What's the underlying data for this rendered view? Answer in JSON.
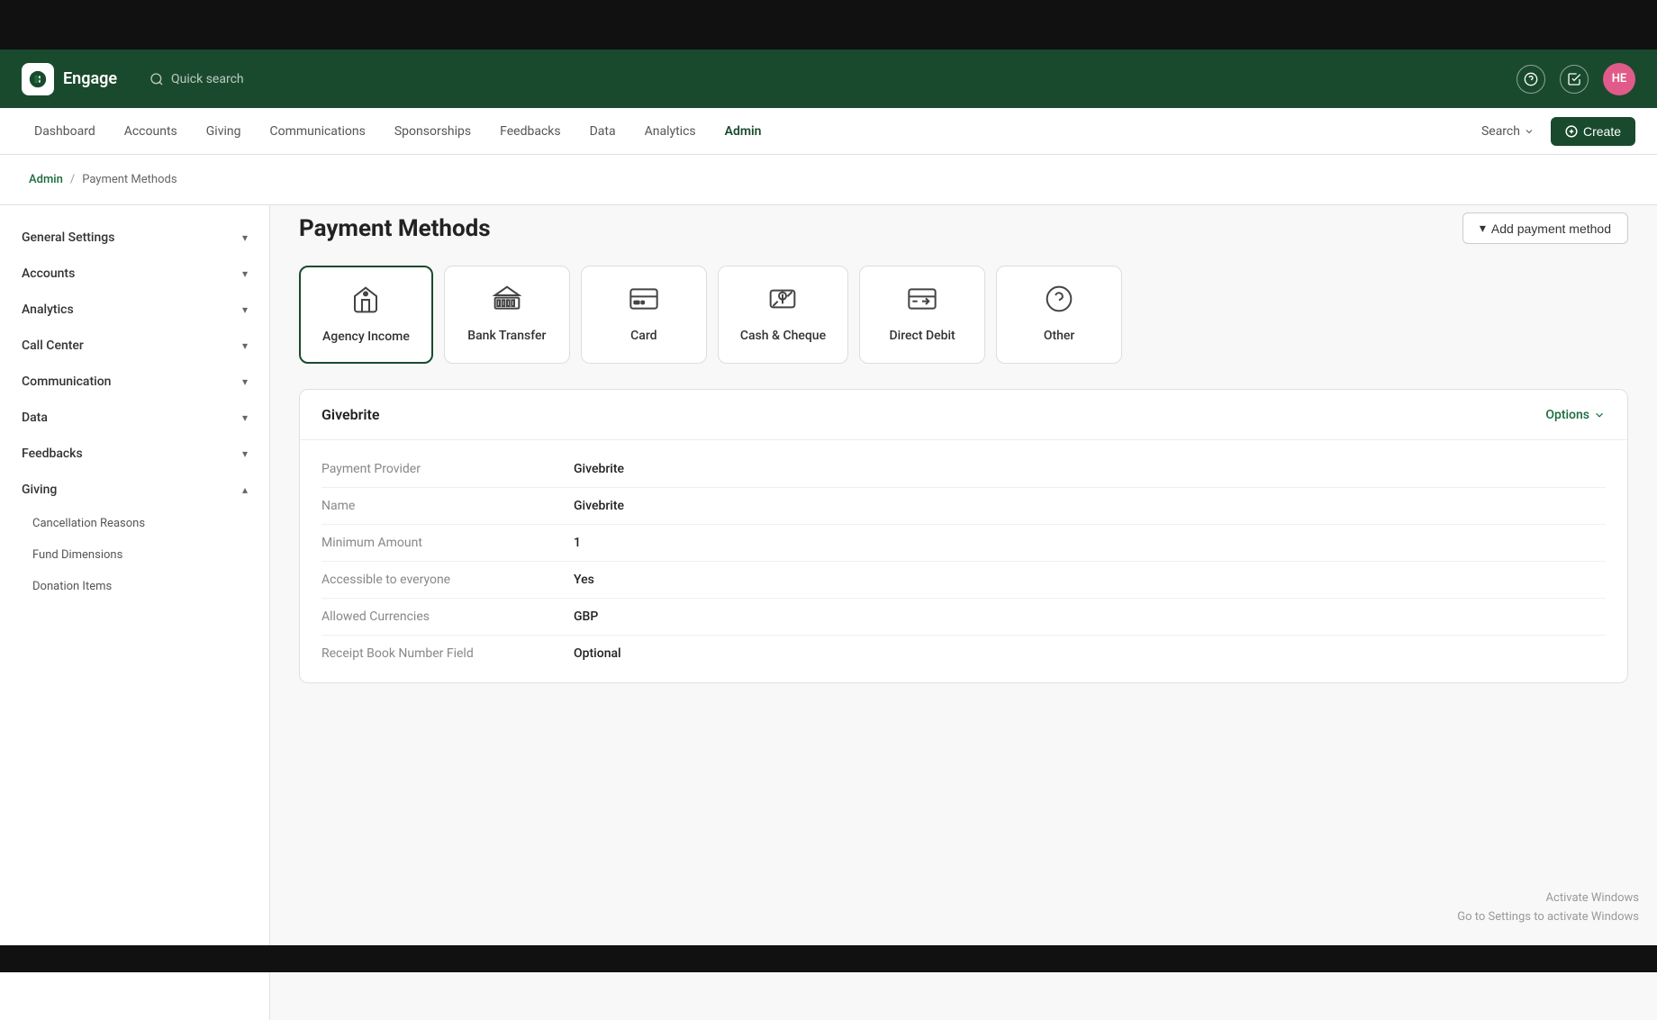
{
  "app": {
    "name": "Engage",
    "logo_alt": "engage-logo"
  },
  "header": {
    "search_placeholder": "Quick search",
    "avatar_initials": "HE"
  },
  "navbar": {
    "items": [
      {
        "label": "Dashboard",
        "active": false
      },
      {
        "label": "Accounts",
        "active": false
      },
      {
        "label": "Giving",
        "active": false
      },
      {
        "label": "Communications",
        "active": false
      },
      {
        "label": "Sponsorships",
        "active": false
      },
      {
        "label": "Feedbacks",
        "active": false
      },
      {
        "label": "Data",
        "active": false
      },
      {
        "label": "Analytics",
        "active": false
      },
      {
        "label": "Admin",
        "active": true
      }
    ],
    "search_label": "Search",
    "create_label": "Create"
  },
  "breadcrumb": {
    "parent": "Admin",
    "current": "Payment Methods"
  },
  "sidebar": {
    "items": [
      {
        "label": "General Settings",
        "expanded": false
      },
      {
        "label": "Accounts",
        "expanded": false
      },
      {
        "label": "Analytics",
        "expanded": false
      },
      {
        "label": "Call Center",
        "expanded": false
      },
      {
        "label": "Communication",
        "expanded": false
      },
      {
        "label": "Data",
        "expanded": false
      },
      {
        "label": "Feedbacks",
        "expanded": false
      },
      {
        "label": "Giving",
        "expanded": true
      }
    ],
    "giving_sub_items": [
      {
        "label": "Cancellation Reasons"
      },
      {
        "label": "Fund Dimensions"
      },
      {
        "label": "Donation Items"
      }
    ]
  },
  "page": {
    "title": "Payment Methods",
    "add_button": "Add payment method"
  },
  "payment_methods": [
    {
      "id": "agency-income",
      "label": "Agency Income",
      "icon": "building",
      "active": true
    },
    {
      "id": "bank-transfer",
      "label": "Bank Transfer",
      "icon": "bank",
      "active": false
    },
    {
      "id": "card",
      "label": "Card",
      "icon": "card",
      "active": false
    },
    {
      "id": "cash-cheque",
      "label": "Cash & Cheque",
      "icon": "cash",
      "active": false
    },
    {
      "id": "direct-debit",
      "label": "Direct Debit",
      "icon": "debit",
      "active": false
    },
    {
      "id": "other",
      "label": "Other",
      "icon": "question",
      "active": false
    }
  ],
  "details": {
    "section_title": "Givebrite",
    "options_label": "Options",
    "fields": [
      {
        "label": "Payment Provider",
        "value": "Givebrite"
      },
      {
        "label": "Name",
        "value": "Givebrite"
      },
      {
        "label": "Minimum Amount",
        "value": "1"
      },
      {
        "label": "Accessible to everyone",
        "value": "Yes"
      },
      {
        "label": "Allowed Currencies",
        "value": "GBP"
      },
      {
        "label": "Receipt Book Number Field",
        "value": "Optional"
      }
    ]
  },
  "watermark": {
    "line1": "Activate Windows",
    "line2": "Go to Settings to activate Windows"
  }
}
